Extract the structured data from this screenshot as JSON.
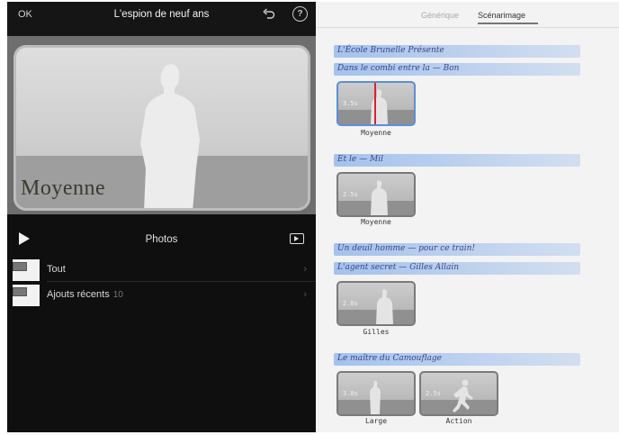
{
  "left_pane": {
    "topbar": {
      "ok_label": "OK",
      "title": "L'espion de neuf ans",
      "undo_icon": "undo-icon",
      "help_icon": "help-icon",
      "help_label": "?"
    },
    "preview": {
      "shot_label": "Moyenne",
      "figure_icon": "standing-man-silhouette"
    },
    "photos": {
      "play_icon": "play-icon",
      "title": "Photos",
      "slideshow_icon": "slideshow-icon",
      "rows": [
        {
          "label": "Tout",
          "count": ""
        },
        {
          "label": "Ajouts récents",
          "count": "10"
        }
      ]
    }
  },
  "right_pane": {
    "tabs": [
      {
        "label": "Générique",
        "active": false
      },
      {
        "label": "Scénarimage",
        "active": true
      }
    ],
    "scenes": [
      {
        "notes": [
          "L'École Brunelle Présente",
          "Dans le combi entre la — Bon"
        ],
        "clips": [
          {
            "name": "Moyenne",
            "tag": "3.5s",
            "selected": true
          }
        ]
      },
      {
        "notes": [
          "Et le — Mil"
        ],
        "clips": [
          {
            "name": "Moyenne",
            "tag": "2.5s",
            "selected": false
          }
        ]
      },
      {
        "notes": [
          "Un deuil homme — pour ce train!",
          "L'agent secret — Gilles Allain"
        ],
        "clips": [
          {
            "name": "Gilles",
            "tag": "2.0s",
            "selected": false
          }
        ]
      },
      {
        "notes": [
          "Le maître du Camouflage"
        ],
        "clips": [
          {
            "name": "Large",
            "tag": "3.0s",
            "selected": false
          },
          {
            "name": "Action",
            "tag": "2.5s",
            "selected": false
          }
        ]
      }
    ]
  },
  "colors": {
    "highlight": "#96b9eb",
    "selected_border": "#5b8fd8",
    "playhead": "#d9232e",
    "dark_bg": "#0f0f0f",
    "light_bg": "#f3f3f3"
  }
}
